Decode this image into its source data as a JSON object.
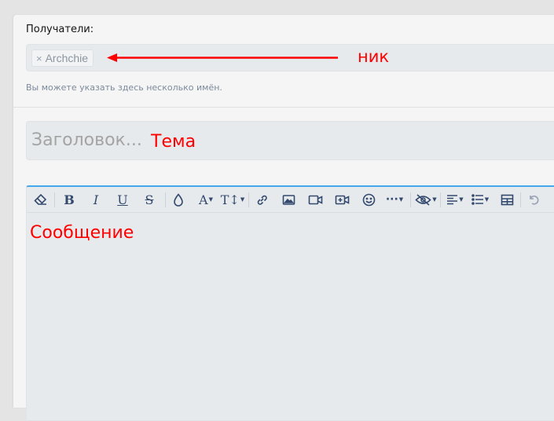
{
  "recipients": {
    "label": "Получатели:",
    "tags": [
      {
        "name": "Archchie",
        "remove_glyph": "×"
      }
    ],
    "hint": "Вы можете указать здесь несколько имён."
  },
  "title": {
    "placeholder": "Заголовок..."
  },
  "editor": {
    "toolbar": [
      "eraser-icon",
      "bold-icon",
      "italic-icon",
      "underline-icon",
      "strikethrough-icon",
      "color-icon",
      "font-family-icon",
      "font-size-icon",
      "link-icon",
      "image-icon",
      "video-icon",
      "media-icon",
      "emoji-icon",
      "more-icon",
      "spoiler-icon",
      "align-icon",
      "list-icon",
      "table-icon",
      "undo-icon"
    ],
    "labels": {
      "bold": "B",
      "italic": "I",
      "underline": "U",
      "strike": "S",
      "font": "A",
      "size": "T↕",
      "more": "···"
    }
  },
  "annotations": {
    "nick": "ник",
    "subject": "Тема",
    "message": "Сообщение"
  },
  "colors": {
    "annotation": "#ff0000",
    "editor_border": "#47a7eb",
    "toolbar_icon": "#34496e"
  }
}
